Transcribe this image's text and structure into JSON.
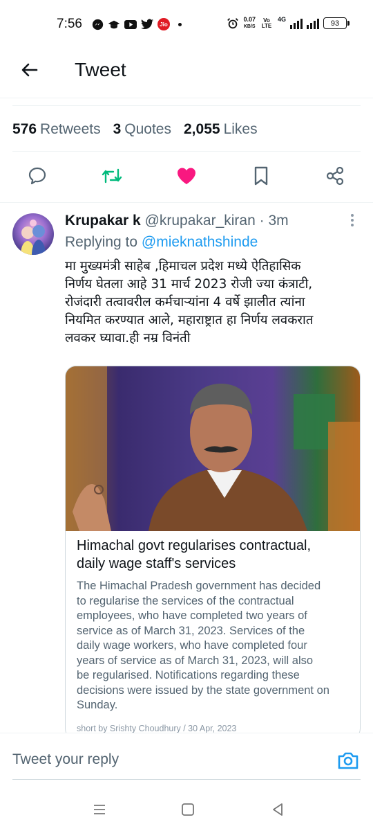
{
  "status_bar": {
    "time": "7:56",
    "net_speed": "0.07",
    "net_unit": "KB/S",
    "volte": "Vo LTE",
    "network": "4G",
    "battery": "93"
  },
  "header": {
    "title": "Tweet",
    "back_icon": "arrow-left-icon"
  },
  "stats": {
    "retweets_count": "576",
    "retweets_label": "Retweets",
    "quotes_count": "3",
    "quotes_label": "Quotes",
    "likes_count": "2,055",
    "likes_label": "Likes"
  },
  "actions": [
    {
      "name": "reply",
      "icon": "comment-icon"
    },
    {
      "name": "retweet",
      "icon": "retweet-icon",
      "color": "#00ba7c"
    },
    {
      "name": "like",
      "icon": "heart-icon",
      "color": "#f91880"
    },
    {
      "name": "bookmark",
      "icon": "bookmark-icon"
    },
    {
      "name": "share",
      "icon": "share-icon"
    }
  ],
  "reply_tweet": {
    "author_name": "Krupakar k",
    "author_handle": "@krupakar_kiran",
    "time_ago": "· 3m",
    "replying_to_label": "Replying to",
    "replying_to_handle": "@mieknathshinde",
    "text_lines": [
      "मा मुख्यमंत्री साहेब ,हिमाचल प्रदेश मध्ये ऐतिहासिक",
      "निर्णय घेतला आहे 31 मार्च 2023 रोजी ज्या कंत्राटी,",
      "रोजंदारी तत्वावरील कर्मचाऱ्यांना 4 वर्षे झालीत त्यांना",
      "नियमित करण्यात आले, महाराष्ट्रात हा निर्णय लवकरात",
      "लवकर घ्यावा.ही नम्र विनंती"
    ]
  },
  "card": {
    "title_lines": [
      "Himachal govt regularises contractual,",
      "daily wage staff's services"
    ],
    "description_lines": [
      "The Himachal Pradesh government has decided",
      "to regularise the services of the contractual",
      "employees, who have completed two years of",
      "service as of March 31, 2023. Services of the",
      "daily wage workers, who have completed four",
      "years of service as of March 31, 2023, will also",
      "be regularised. Notifications regarding these",
      "decisions were issued by the state government on",
      "Sunday."
    ],
    "source": "short by Srishty Choudhury / 30 Apr, 2023"
  },
  "reply_bar": {
    "placeholder": "Tweet your reply",
    "accent": "#1d9bf0"
  }
}
